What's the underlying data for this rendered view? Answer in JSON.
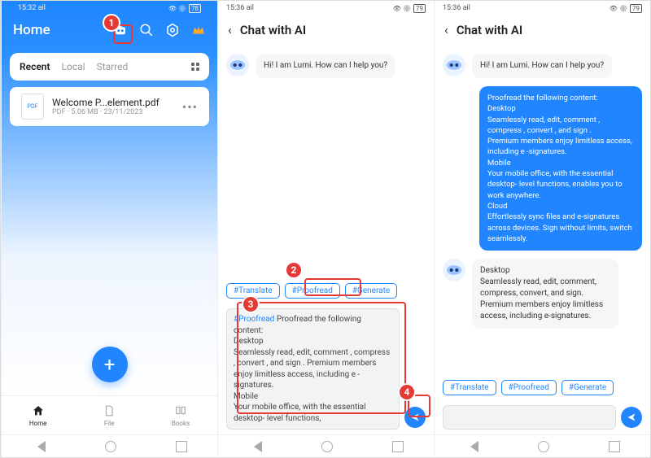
{
  "panel1": {
    "time": "15:32",
    "signal": "ail",
    "battery": "78",
    "title": "Home",
    "tabs": [
      "Recent",
      "Local",
      "Starred"
    ],
    "file": {
      "name": "Welcome P...element.pdf",
      "type": "PDF",
      "size": "5.06 MB",
      "date": "23/11/2023"
    },
    "dock": [
      "Home",
      "File",
      "Books"
    ]
  },
  "panel2": {
    "time": "15:36",
    "signal": "ail",
    "battery": "79",
    "title": "Chat with AI",
    "ai_greeting": "Hi! I am Lumi. How can I help you?",
    "chips": [
      "#Translate",
      "#Proofread",
      "#Generate"
    ],
    "input_tag": "#Proofread",
    "input_text": "Proofread the following content:\nDesktop\nSeamlessly read, edit, comment , compress , convert , and sign . Premium members enjoy limitless access, including e -signatures.\nMobile\nYour mobile office, with the essential desktop- level functions,"
  },
  "panel3": {
    "time": "15:36",
    "signal": "ail",
    "battery": "79",
    "title": "Chat with AI",
    "ai_greeting": "Hi! I am Lumi. How can I help you?",
    "user_msg": "Proofread the following content:\nDesktop\nSeamlessly read, edit, comment , compress , convert , and sign .\nPremium members enjoy limitless access, including e -signatures.\nMobile\nYour mobile office, with the essential desktop- level functions, enables you to work anywhere.\nCloud\nEffortlessly sync files and e-signatures across devices. Sign without limits, switch seamlessly.",
    "ai_reply": "Desktop\nSeamlessly read, edit, comment, compress, convert, and sign.\nPremium members enjoy limitless access, including e-signatures.",
    "chips": [
      "#Translate",
      "#Proofread",
      "#Generate"
    ]
  },
  "annotations": [
    "1",
    "2",
    "3",
    "4"
  ]
}
